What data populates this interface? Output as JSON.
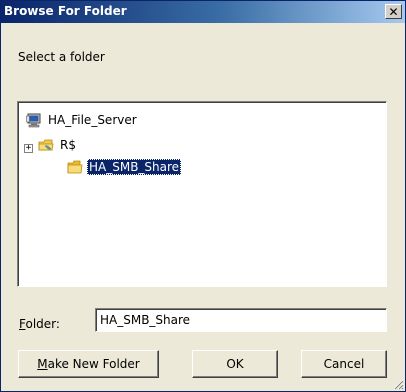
{
  "window": {
    "title": "Browse For Folder",
    "close_glyph": "✕"
  },
  "instruction": "Select a folder",
  "tree": {
    "nodes": [
      {
        "label": "HA_File_Server",
        "icon": "computer-icon",
        "expander": ""
      },
      {
        "label": "R$",
        "icon": "shared-folder-icon",
        "expander": "+"
      },
      {
        "label": "HA_SMB_Share",
        "icon": "folder-icon",
        "expander": "",
        "selected": true
      }
    ]
  },
  "folder_field": {
    "label_mnemonic": "F",
    "label_rest": "older:",
    "value": "HA_SMB_Share"
  },
  "buttons": {
    "make_new_mnemonic": "M",
    "make_new_rest": "ake New Folder",
    "ok": "OK",
    "cancel": "Cancel"
  },
  "colors": {
    "title_bar": "#0a246a",
    "selection": "#0a246a",
    "dialog_bg": "#ece9d8",
    "folder_yellow": "#f2c94c"
  }
}
